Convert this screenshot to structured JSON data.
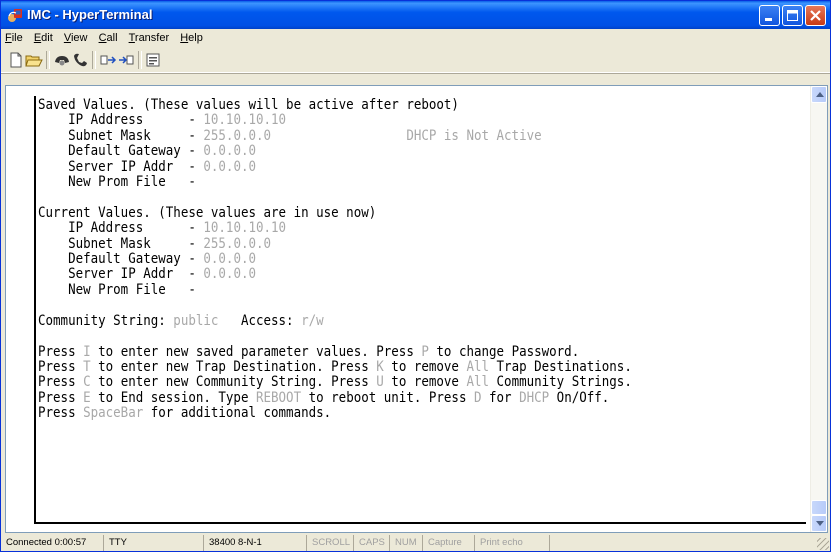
{
  "window": {
    "title": "IMC - HyperTerminal",
    "colors": {
      "titlebar": "#0058EE",
      "terminal_bg": "#FFFFFF",
      "terminal_text": "#000000",
      "terminal_dim": "#A8A8A8"
    }
  },
  "menu": {
    "file": {
      "u": "F",
      "rest": "ile"
    },
    "edit": {
      "u": "E",
      "rest": "dit"
    },
    "view": {
      "u": "V",
      "rest": "iew"
    },
    "call": {
      "u": "C",
      "rest": "all"
    },
    "transfer": {
      "u": "T",
      "rest": "ransfer"
    },
    "help": {
      "u": "H",
      "rest": "elp"
    }
  },
  "toolbar": {
    "icons": [
      "new-icon",
      "open-icon",
      "disconnect-icon",
      "dial-icon",
      "send-icon",
      "receive-icon",
      "properties-icon"
    ]
  },
  "terminal": {
    "saved_header": "Saved Values. (These values will be active after reboot)",
    "saved_ip_label": "    IP Address      - ",
    "saved_ip": "10.10.10.10",
    "saved_mask_label": "    Subnet Mask     - ",
    "saved_mask": "255.0.0.0",
    "saved_dhcp_pad": "                  ",
    "saved_dhcp": "DHCP is Not Active",
    "saved_gw_label": "    Default Gateway - ",
    "saved_gw": "0.0.0.0",
    "saved_server_label": "    Server IP Addr  - ",
    "saved_server": "0.0.0.0",
    "saved_prom_label": "    New Prom File   -",
    "current_header": "Current Values. (These values are in use now)",
    "cur_ip_label": "    IP Address      - ",
    "cur_ip": "10.10.10.10",
    "cur_mask_label": "    Subnet Mask     - ",
    "cur_mask": "255.0.0.0",
    "cur_gw_label": "    Default Gateway - ",
    "cur_gw": "0.0.0.0",
    "cur_server_label": "    Server IP Addr  - ",
    "cur_server": "0.0.0.0",
    "cur_prom_label": "    New Prom File   -",
    "community_label": "Community String: ",
    "community_value": "public",
    "access_label": "   Access: ",
    "access_value": "r/w",
    "p1_a": "Press ",
    "p1_k": "I",
    "p1_b": " to enter new saved parameter values. Press ",
    "p1_k2": "P",
    "p1_c": " to change Password.",
    "p2_a": "Press ",
    "p2_k": "T",
    "p2_b": " to enter new Trap Destination. Press ",
    "p2_k2": "K",
    "p2_c": " to remove ",
    "p2_k3": "All",
    "p2_d": " Trap Destinations.",
    "p3_a": "Press ",
    "p3_k": "C",
    "p3_b": " to enter new Community String. Press ",
    "p3_k2": "U",
    "p3_c": " to remove ",
    "p3_k3": "All",
    "p3_d": " Community Strings.",
    "p4_a": "Press ",
    "p4_k": "E",
    "p4_b": " to End session. Type ",
    "p4_k2": "REBOOT",
    "p4_c": " to reboot unit. Press ",
    "p4_k3": "D",
    "p4_d": " for ",
    "p4_k4": "DHCP",
    "p4_e": " On/Off.",
    "p5_a": "Press ",
    "p5_k": "SpaceBar",
    "p5_b": " for additional commands."
  },
  "status": {
    "connected": "Connected 0:00:57",
    "emulation": "TTY",
    "settings": "38400 8-N-1",
    "scroll": "SCROLL",
    "caps": "CAPS",
    "num": "NUM",
    "capture": "Capture",
    "print_echo": "Print echo"
  }
}
